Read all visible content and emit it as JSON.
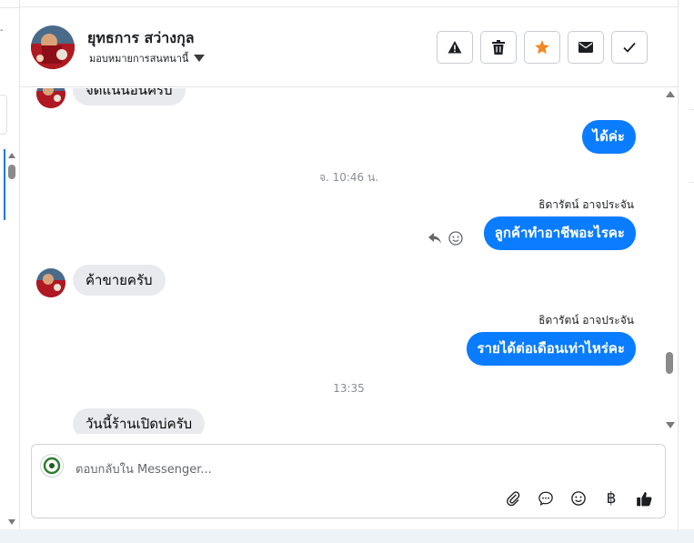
{
  "header": {
    "contact_name": "ยุทธการ สว่างกุล",
    "assign_label": "มอบหมายการสนทนานี้",
    "buttons": [
      {
        "name": "report-button",
        "icon": "warning-icon"
      },
      {
        "name": "delete-button",
        "icon": "trash-icon"
      },
      {
        "name": "star-button",
        "icon": "star-icon"
      },
      {
        "name": "mark-unread-button",
        "icon": "envelope-icon"
      },
      {
        "name": "mark-done-button",
        "icon": "check-icon"
      }
    ]
  },
  "messages": [
    {
      "from": "contact",
      "text": "จัดแน่นอนครับ"
    },
    {
      "from": "page",
      "text": "ได้ค่ะ"
    },
    {
      "type": "timestamp",
      "text": "จ. 10:46 น."
    },
    {
      "from": "page",
      "sender": "ธิดารัตน์ อาจประจัน",
      "text": "ลูกค้าทำอาชีพอะไรคะ"
    },
    {
      "from": "contact",
      "text": "ค้าขายครับ"
    },
    {
      "from": "page",
      "sender": "ธิดารัตน์ อาจประจัน",
      "text": "รายได้ต่อเดือนเท่าไหร่คะ"
    },
    {
      "type": "timestamp",
      "text": "13:35"
    },
    {
      "from": "contact",
      "text": "วันนี้ร้านเปิดบ่ครับ"
    }
  ],
  "composer": {
    "placeholder": "ตอบกลับใน Messenger...",
    "tools": [
      "attachment-icon",
      "saved-reply-icon",
      "emoji-icon",
      "baht-icon",
      "like-icon"
    ],
    "baht_symbol": "฿"
  },
  "colors": {
    "outgoing_bubble": "#0a7cff",
    "incoming_bubble": "#e9eaee",
    "star": "#f08a24"
  }
}
